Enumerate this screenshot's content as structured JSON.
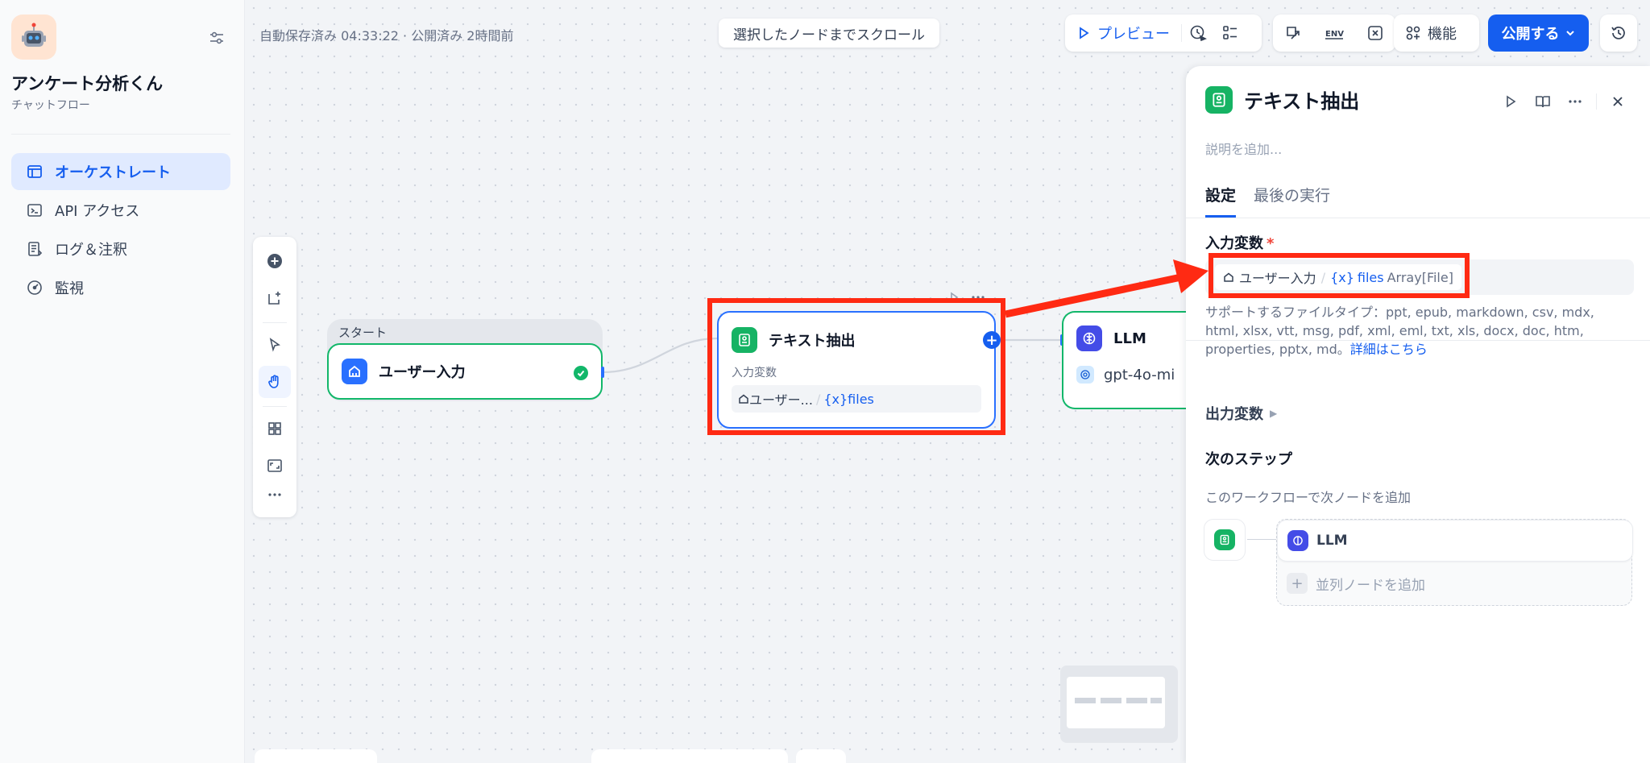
{
  "app": {
    "name": "アンケート分析くん",
    "type": "チャットフロー"
  },
  "nav": [
    {
      "label": "オーケストレート",
      "icon": "orchestrate-icon",
      "active": true
    },
    {
      "label": "API アクセス",
      "icon": "terminal-icon",
      "active": false
    },
    {
      "label": "ログ＆注釈",
      "icon": "log-icon",
      "active": false
    },
    {
      "label": "監視",
      "icon": "monitor-icon",
      "active": false
    }
  ],
  "canvas": {
    "status": "自動保存済み 04:33:22 · 公開済み 2時間前",
    "scroll_to_node": "選択したノードまでスクロール"
  },
  "toolbar": {
    "preview": "プレビュー",
    "features": "機能",
    "publish": "公開する"
  },
  "nodes": {
    "start_group_label": "スタート",
    "start_title": "ユーザー入力",
    "extract_title": "テキスト抽出",
    "extract_input_label": "入力変数",
    "extract_var_node": "ユーザー...",
    "extract_var_name": "files",
    "llm_title": "LLM",
    "llm_model": "gpt-4o-mi"
  },
  "panel": {
    "title": "テキスト抽出",
    "description_placeholder": "説明を追加...",
    "tabs": [
      "設定",
      "最後の実行"
    ],
    "input_section": "入力変数",
    "var_node": "ユーザー入力",
    "var_name": "files",
    "var_type": "Array[File]",
    "support_text": "サポートするファイルタイプ：ppt, epub, markdown, csv, mdx, html, xlsx, vtt, msg, pdf, xml, eml, txt, xls, docx, doc, htm, properties, pptx, md。",
    "support_link": "詳細はこちら",
    "output_section": "出力変数",
    "next_step_title": "次のステップ",
    "next_step_sub": "このワークフローで次ノードを追加",
    "next_node_label": "LLM",
    "add_parallel": "並列ノードを追加"
  },
  "colors": {
    "accent": "#155eef",
    "success": "#12b76a",
    "highlight": "#ff2a13"
  }
}
